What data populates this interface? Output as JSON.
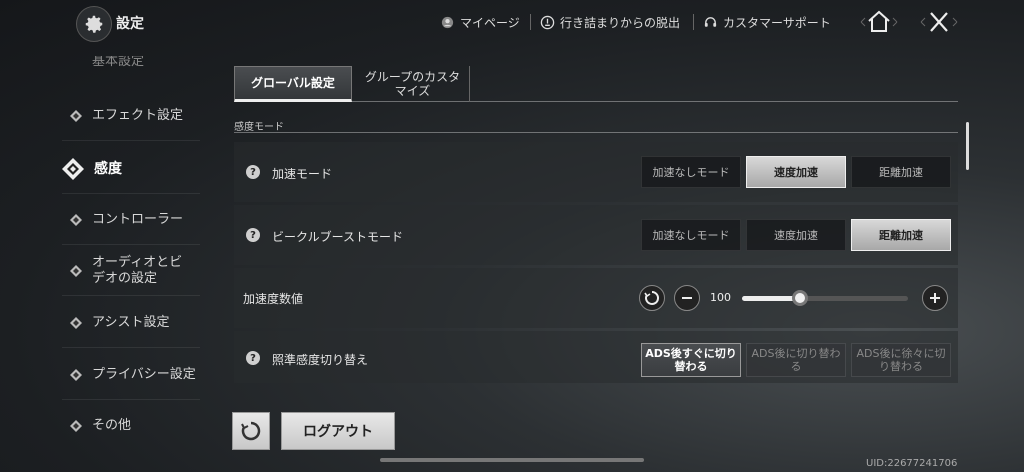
{
  "header": {
    "title": "設定",
    "links": [
      {
        "label": "マイページ",
        "icon": "user-icon"
      },
      {
        "label": "行き詰まりからの脱出",
        "icon": "escape-icon"
      },
      {
        "label": "カスタマーサポート",
        "icon": "headset-icon"
      }
    ]
  },
  "sidebar": {
    "partial_item": "基本設定",
    "items": [
      {
        "label": "エフェクト設定"
      },
      {
        "label": "感度"
      },
      {
        "label": "コントローラー"
      },
      {
        "label": "オーディオとビデオの設定"
      },
      {
        "label": "アシスト設定"
      },
      {
        "label": "プライバシー設定"
      },
      {
        "label": "その他"
      }
    ],
    "active_index": 1
  },
  "tabs": [
    {
      "label": "グローバル設定"
    },
    {
      "label": "グループのカスタマイズ"
    }
  ],
  "section": {
    "label": "感度モード"
  },
  "settings": {
    "accel_mode": {
      "help": "?",
      "label": "加速モード",
      "options": [
        "加速なしモード",
        "速度加速",
        "距離加速"
      ],
      "selected": "速度加速"
    },
    "vehicle_boost": {
      "help": "?",
      "label": "ビークルブーストモード",
      "options": [
        "加速なしモード",
        "速度加速",
        "距離加速"
      ],
      "selected": "距離加速"
    },
    "accel_value": {
      "label": "加速度数値",
      "value": "100",
      "slider_fraction": 0.35
    },
    "aim_switch": {
      "help": "?",
      "label": "照準感度切り替え",
      "options": [
        "ADS後すぐに切り替わる",
        "ADS後に切り替わる",
        "ADS後に徐々に切り替わる"
      ],
      "selected": "ADS後すぐに切り替わる"
    }
  },
  "footer": {
    "logout_label": "ログアウト",
    "uid": "UID:22677241706"
  }
}
